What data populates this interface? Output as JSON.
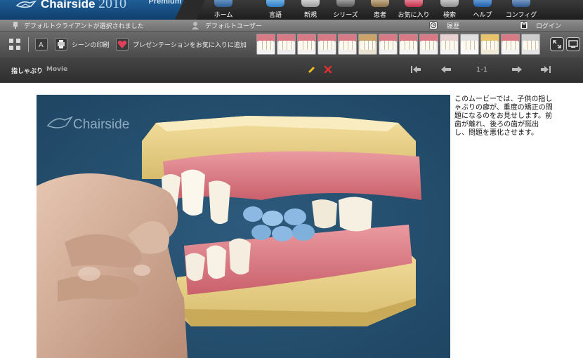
{
  "app": {
    "name": "Chairside",
    "year": "2010",
    "edition": "Premium"
  },
  "nav": {
    "home": "ホーム",
    "language": "言語",
    "new": "新規",
    "series": "シリーズ",
    "patients": "患者",
    "favorites": "お気に入り",
    "search": "検索",
    "help": "ヘルプ",
    "config": "コンフィグ"
  },
  "status": {
    "client": "デフォルトクライアントが選択されました",
    "user": "デフォルトユーザー",
    "history": "履歴",
    "login": "ログイン"
  },
  "toolbar": {
    "print_scene": "シーンの印刷",
    "add_favorite": "プレゼンテーションをお気に入りに追加"
  },
  "player": {
    "title": "指しゃぶり",
    "type": "Movie",
    "page": "1-1",
    "watermark": "Chairside"
  },
  "description": "このムービーでは、子供の指しゃぶりの癖が、重度の矯正の問題になるのをお見せします。前歯が離れ、後ろの歯が挺出し、問題を悪化させます。",
  "icons": {
    "edit": "pencil-icon",
    "delete": "x-icon",
    "first": "first-page-icon",
    "prev": "prev-arrow-icon",
    "next": "next-arrow-icon",
    "last": "last-page-icon"
  },
  "colors": {
    "brand_blue": "#1a5a8f",
    "movie_bg": "#26506f",
    "edit_yellow": "#f0c020",
    "delete_red": "#e03030",
    "gum_pink": "#e07f86"
  }
}
